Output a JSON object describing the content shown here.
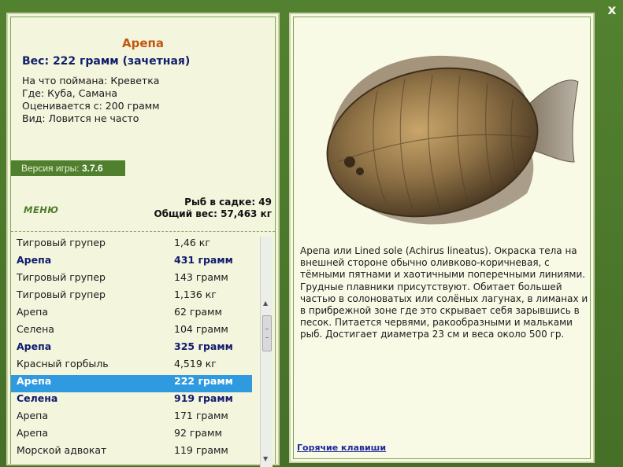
{
  "window": {
    "close_label": "x"
  },
  "fish": {
    "name": "Арепа",
    "weight_line": "Вес: 222 грамм (зачетная)",
    "caught_on": "На что поймана: Креветка",
    "where": "Где: Куба, Самана",
    "rated_from": "Оценивается с: 200 грамм",
    "kind": "Вид: Ловится не часто"
  },
  "version": {
    "label": "Версия игры:",
    "value": "3.7.6"
  },
  "menu_label": "МЕНЮ",
  "stats": {
    "fish_in_keepnet": "Рыб в садке: 49",
    "total_weight": "Общий вес: 57,463 кг"
  },
  "catch_list": [
    {
      "name": "Тигровый групер",
      "weight": "1,46 кг",
      "style": "normal"
    },
    {
      "name": "Арепа",
      "weight": "431 грамм",
      "style": "bold"
    },
    {
      "name": "Тигровый групер",
      "weight": "143 грамм",
      "style": "normal"
    },
    {
      "name": "Тигровый групер",
      "weight": "1,136 кг",
      "style": "normal"
    },
    {
      "name": "Арепа",
      "weight": "62 грамм",
      "style": "normal"
    },
    {
      "name": "Селена",
      "weight": "104 грамм",
      "style": "normal"
    },
    {
      "name": "Арепа",
      "weight": "325 грамм",
      "style": "bold"
    },
    {
      "name": "Красный горбыль",
      "weight": "4,519 кг",
      "style": "normal"
    },
    {
      "name": "Арепа",
      "weight": "222 грамм",
      "style": "selected"
    },
    {
      "name": "Селена",
      "weight": "919 грамм",
      "style": "bold"
    },
    {
      "name": "Арепа",
      "weight": "171 грамм",
      "style": "normal"
    },
    {
      "name": "Арепа",
      "weight": "92 грамм",
      "style": "normal"
    },
    {
      "name": "Морской адвокат",
      "weight": "119 грамм",
      "style": "normal"
    }
  ],
  "description": "Арепа или Lined sole (Achirus lineatus). Окраска тела на внешней стороне обычно оливково-коричневая, с тёмными пятнами и хаотичными поперечными линиями. Грудные плавники присутствуют. Обитает большей частью в солоноватых или солёных лагунах, в лиманах и в прибрежной зоне где это скрывает себя зарывшись в песок. Питается червями, ракообразными и мальками рыб. Достигает диаметра 23 см и веса около 500 гр.",
  "hotkeys_label": "Горячие клавиши",
  "colors": {
    "frame_green": "#4b7a2c",
    "fish_name": "#c2570f",
    "weight_blue": "#101e6a",
    "selected_row": "#2f9ae0",
    "link_blue": "#1e2a9a"
  }
}
